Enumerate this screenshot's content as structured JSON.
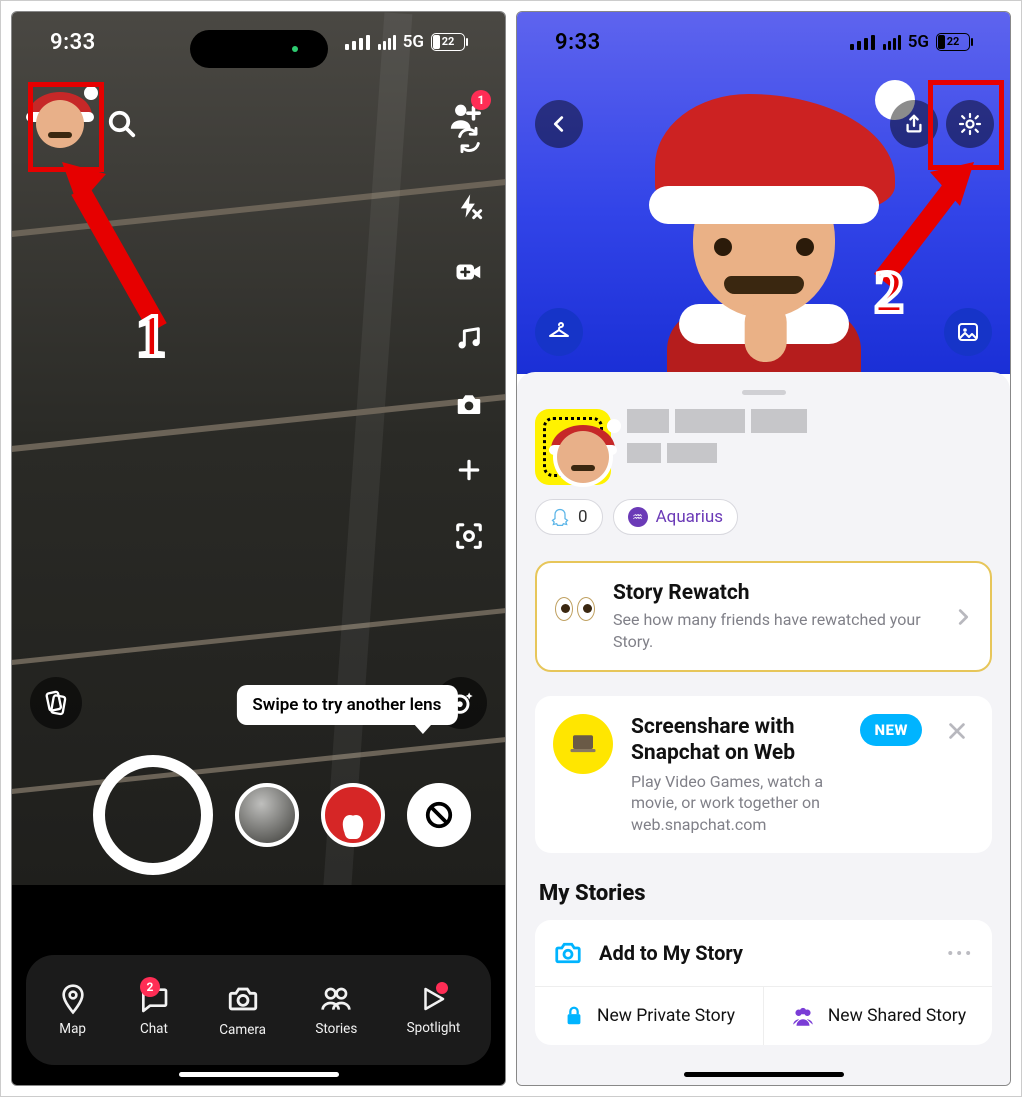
{
  "status": {
    "time": "9:33",
    "network": "5G",
    "battery_pct": "22"
  },
  "left": {
    "sidebar_tools": [
      "flip",
      "flash",
      "video-call",
      "music",
      "camera-mode",
      "add",
      "scan"
    ],
    "add_friend_badge": "1",
    "lens_tip": "Swipe to try another lens",
    "nav": {
      "map": "Map",
      "chat": "Chat",
      "chat_badge": "2",
      "camera": "Camera",
      "stories": "Stories",
      "spotlight": "Spotlight"
    }
  },
  "right": {
    "snapscore": "0",
    "zodiac": "Aquarius",
    "story_rewatch": {
      "title": "Story Rewatch",
      "subtitle": "See how many friends have rewatched your Story."
    },
    "screenshare": {
      "title": "Screenshare with Snapchat on Web",
      "subtitle": "Play Video Games, watch a movie, or work together on web.snapchat.com",
      "pill": "NEW"
    },
    "my_stories": {
      "section": "My Stories",
      "add": "Add to My Story",
      "private": "New Private Story",
      "shared": "New Shared Story"
    }
  },
  "annotations": {
    "step1": "1",
    "step2": "2"
  }
}
